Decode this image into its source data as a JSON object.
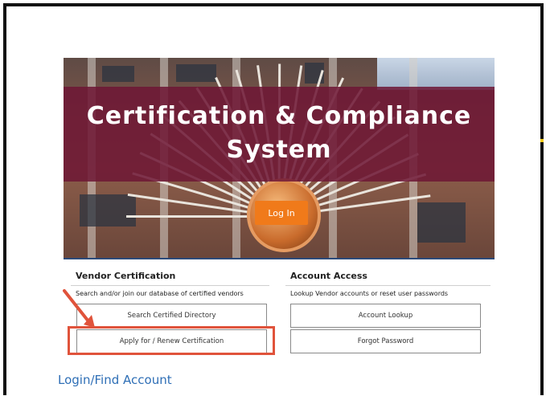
{
  "hero": {
    "title_line1": "Certification & Compliance",
    "title_line2": "System",
    "login_button": "Log In"
  },
  "vendor_certification": {
    "heading": "Vendor Certification",
    "description": "Search and/or join our database of certified vendors",
    "search_button": "Search Certified Directory",
    "apply_button": "Apply for / Renew Certification"
  },
  "account_access": {
    "heading": "Account Access",
    "description": "Lookup Vendor accounts or reset user passwords",
    "lookup_button": "Account Lookup",
    "forgot_button": "Forgot Password"
  },
  "footer": {
    "link": "Login/Find Account"
  },
  "colors": {
    "banner": "#6e1634",
    "login_button": "#f07a1a",
    "annotation": "#e0533b",
    "link": "#2f6fb6"
  }
}
